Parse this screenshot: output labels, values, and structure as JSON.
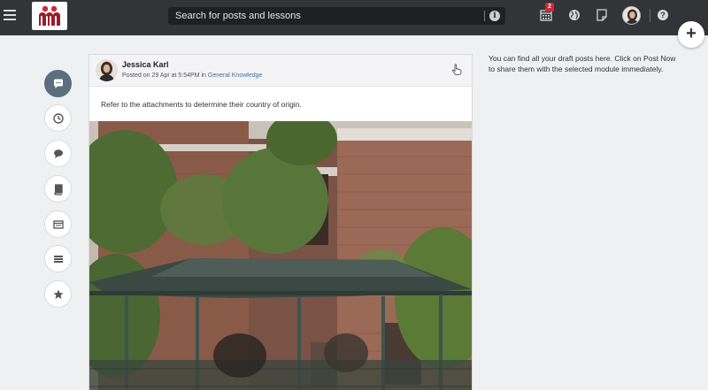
{
  "header": {
    "search": {
      "placeholder": "Search for posts and lessons",
      "value": ""
    },
    "notifications_count": "2",
    "icons": [
      "menu-icon",
      "calendar-icon",
      "globe-icon",
      "notes-icon",
      "user-avatar",
      "help-icon"
    ],
    "help_glyph": "?",
    "info_glyph": "i",
    "plus_glyph": "+"
  },
  "brand": {
    "logo_colors": [
      "#d0283a",
      "#9b1c2b"
    ],
    "accent_active": "#5d6d80"
  },
  "rail": {
    "items": [
      {
        "icon": "posts-icon",
        "active": true
      },
      {
        "icon": "clock-icon",
        "active": false
      },
      {
        "icon": "comment-icon",
        "active": false
      },
      {
        "icon": "book-icon",
        "active": false
      },
      {
        "icon": "calendar-card-icon",
        "active": false
      },
      {
        "icon": "stack-icon",
        "active": false
      },
      {
        "icon": "star-icon",
        "active": false
      }
    ]
  },
  "post": {
    "author": "Jessica Karl",
    "posted_prefix": "Posted on 29 Apr at 5:54PM in",
    "module": "General Knowledge",
    "text": "Refer to the attachments to determine their country of origin."
  },
  "side_note": "You can find all your draft posts here. Click on Post Now to share them with the selected module immediately."
}
